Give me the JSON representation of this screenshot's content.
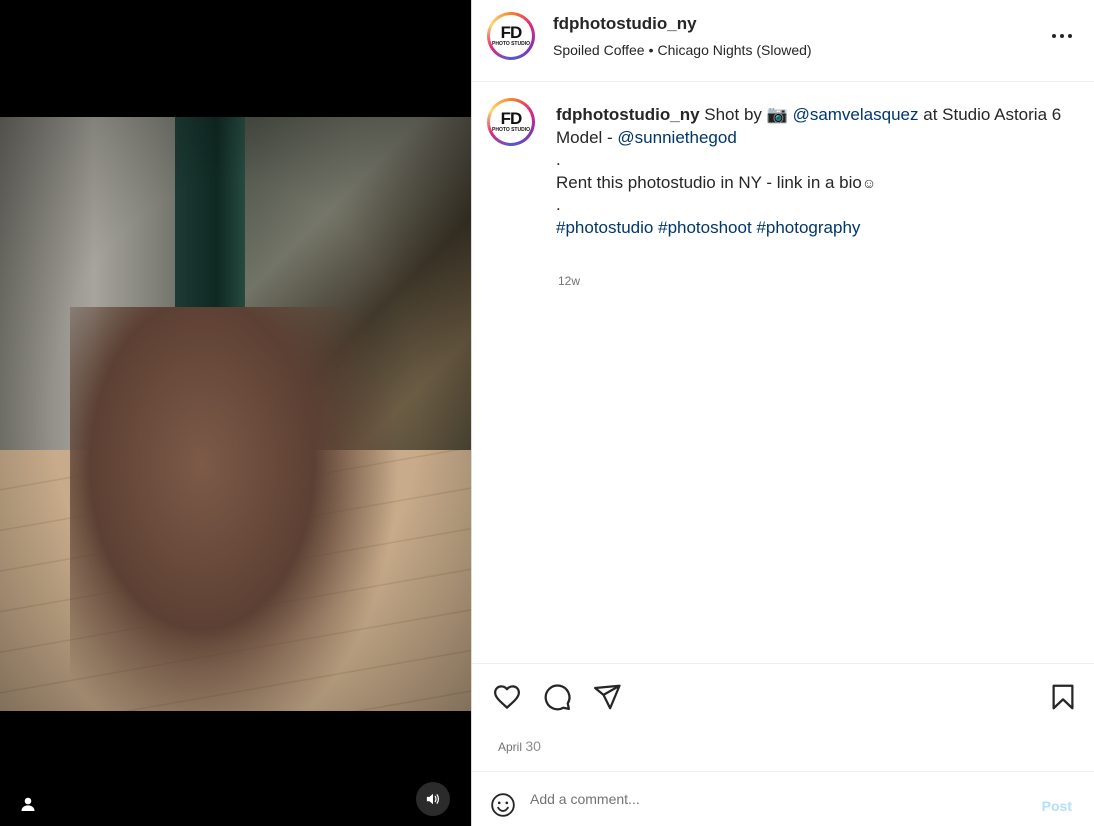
{
  "media": {
    "user_tag_icon": "person-icon",
    "audio_icon": "speaker-icon"
  },
  "header": {
    "username": "fdphotostudio_ny",
    "audio_artist": "Spoiled Coffee",
    "audio_separator": "•",
    "audio_track": "Chicago Nights (Slowed)",
    "avatar_text_main": "FD",
    "avatar_text_sub": "PHOTO STUDIO",
    "more_icon": "more-horizontal-icon"
  },
  "caption": {
    "username": "fdphotostudio_ny",
    "text_1": "Shot by",
    "camera_emoji": "📷",
    "mention_1": "@samvelasquez",
    "text_2": "at Studio Astoria 6",
    "model_prefix": "Model -",
    "mention_2": "@sunniethegod",
    "dot_1": ".",
    "rent_text": "Rent this photostudio in NY - link in a bio",
    "smile_emoji": "☺",
    "dot_2": ".",
    "hashtag_1": "#photostudio",
    "hashtag_2": "#photoshoot",
    "hashtag_3": "#photography",
    "time_ago": "12w"
  },
  "actions": {
    "like_icon": "heart-icon",
    "comment_icon": "comment-icon",
    "share_icon": "send-icon",
    "save_icon": "bookmark-icon",
    "date_month": "April",
    "date_day": "30"
  },
  "comment_box": {
    "emoji_icon": "smiley-icon",
    "placeholder": "Add a comment...",
    "post_label": "Post"
  },
  "colors": {
    "link": "#00376b",
    "muted": "#737373",
    "post_disabled": "#b2dffc",
    "text": "#262626"
  }
}
